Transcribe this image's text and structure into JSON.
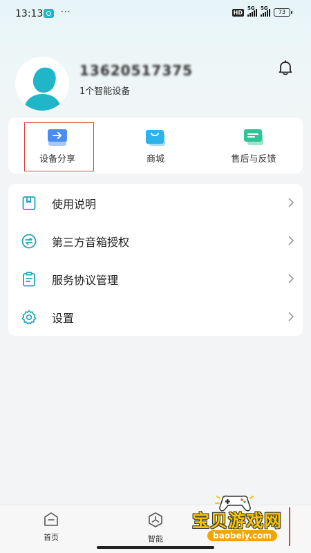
{
  "status_bar": {
    "time": "13:13",
    "dots": "···",
    "hd": "HD",
    "net1": "5G",
    "net2": "5G",
    "battery": "73"
  },
  "profile": {
    "phone": "13620517375",
    "device_count": "1个智能设备"
  },
  "quick_actions": [
    {
      "label": "设备分享",
      "icon": "device-share-icon"
    },
    {
      "label": "商城",
      "icon": "shopping-bag-icon"
    },
    {
      "label": "售后与反馈",
      "icon": "feedback-chat-icon"
    }
  ],
  "menu": [
    {
      "label": "使用说明",
      "icon": "book-icon"
    },
    {
      "label": "第三方音箱授权",
      "icon": "transfer-icon"
    },
    {
      "label": "服务协议管理",
      "icon": "clipboard-icon"
    },
    {
      "label": "设置",
      "icon": "gear-icon"
    }
  ],
  "bottom_nav": [
    {
      "label": "首页",
      "icon": "home-icon"
    },
    {
      "label": "智能",
      "icon": "smart-icon"
    }
  ],
  "watermark": {
    "title": "宝贝游戏网",
    "url": "baobeiy.com"
  },
  "colors": {
    "accent": "#1fb6c8",
    "highlight": "#d9413c",
    "icon_blue": "#4a8cf0"
  }
}
